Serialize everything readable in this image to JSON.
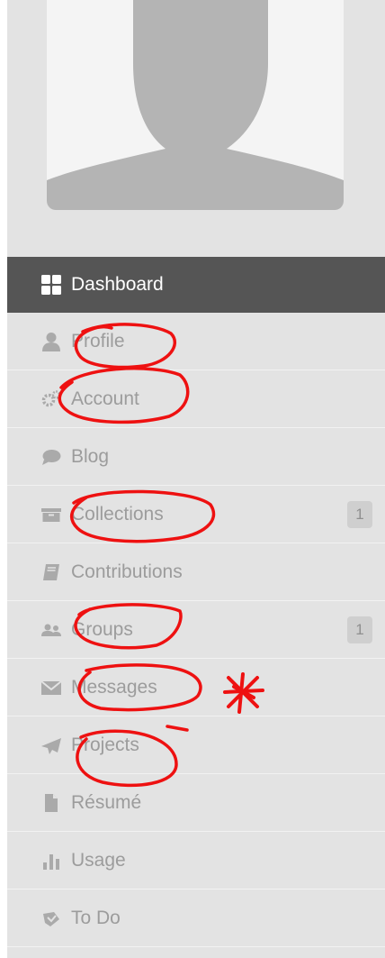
{
  "sidebar": {
    "items": [
      {
        "label": "Dashboard",
        "icon": "dashboard-icon",
        "active": true
      },
      {
        "label": "Profile",
        "icon": "user-icon"
      },
      {
        "label": "Account",
        "icon": "gears-icon"
      },
      {
        "label": "Blog",
        "icon": "comment-icon"
      },
      {
        "label": "Collections",
        "icon": "archive-icon",
        "badge": "1"
      },
      {
        "label": "Contributions",
        "icon": "book-icon"
      },
      {
        "label": "Groups",
        "icon": "users-icon",
        "badge": "1"
      },
      {
        "label": "Messages",
        "icon": "envelope-icon"
      },
      {
        "label": "Projects",
        "icon": "paper-plane-icon"
      },
      {
        "label": "Résumé",
        "icon": "file-icon"
      },
      {
        "label": "Usage",
        "icon": "bar-chart-icon"
      },
      {
        "label": "To Do",
        "icon": "todo-icon"
      }
    ]
  },
  "colors": {
    "sidebar_bg": "#e3e3e3",
    "active_bg": "#555555",
    "text": "#9c9c9c",
    "annotation": "#ee1111"
  }
}
